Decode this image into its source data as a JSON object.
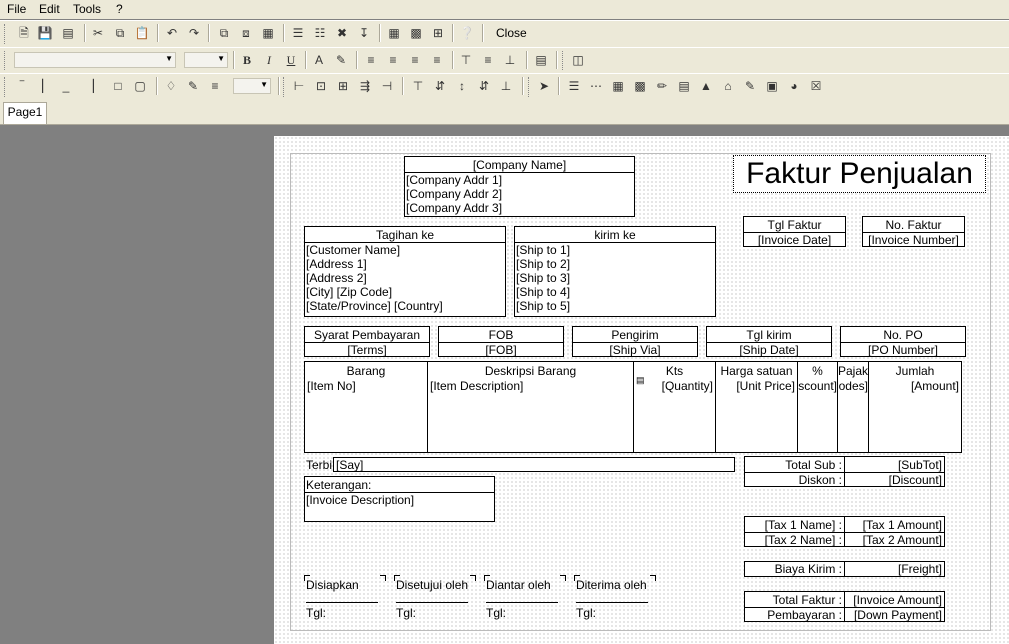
{
  "menu": {
    "file": "File",
    "edit": "Edit",
    "tools": "Tools",
    "help": "?"
  },
  "toolbar": {
    "close_label": "Close"
  },
  "tabs": {
    "page1": "Page1"
  },
  "report": {
    "title": "Faktur Penjualan",
    "company": {
      "name": "[Company Name]",
      "addr1": "[Company Addr 1]",
      "addr2": "[Company Addr 2]",
      "addr3": "[Company Addr 3]"
    },
    "invoice_date_label": "Tgl Faktur",
    "invoice_date": "[Invoice Date]",
    "invoice_no_label": "No. Faktur",
    "invoice_no": "[Invoice Number]",
    "bill_to": {
      "header": "Tagihan ke",
      "lines": [
        "[Customer Name]",
        "[Address 1]",
        "[Address 2]",
        "[City] [Zip Code]",
        "[State/Province] [Country]"
      ]
    },
    "ship_to": {
      "header": "kirim ke",
      "lines": [
        "[Ship to 1]",
        "[Ship to 2]",
        "[Ship to 3]",
        "[Ship to 4]",
        "[Ship to 5]"
      ]
    },
    "info": [
      {
        "label": "Syarat Pembayaran",
        "value": "[Terms]"
      },
      {
        "label": "FOB",
        "value": "[FOB]"
      },
      {
        "label": "Pengirim",
        "value": "[Ship Via]"
      },
      {
        "label": "Tgl kirim",
        "value": "[Ship Date]"
      },
      {
        "label": "No. PO",
        "value": "[PO Number]"
      }
    ],
    "items": {
      "headers": {
        "item": "Barang",
        "desc": "Deskripsi Barang",
        "qty": "Kts",
        "price": "Harga satuan",
        "disc": "%",
        "tax": "Pajak",
        "amount": "Jumlah"
      },
      "fields": {
        "item": "[Item No]",
        "desc": "[Item Description]",
        "qty": "[Quantity]",
        "price": "[Unit Price]",
        "disc": "[Discount]",
        "tax": "[Codes]",
        "amount": "[Amount]"
      }
    },
    "say_label": "Terbilang",
    "say": "[Say]",
    "note_label": "Keterangan:",
    "note": "[Invoice Description]",
    "totals": {
      "subtotal_label": "Total Sub :",
      "subtotal": "[SubTot]",
      "discount_label": "Diskon :",
      "discount": "[Discount]",
      "tax1_label": "[Tax 1 Name] :",
      "tax1": "[Tax 1 Amount]",
      "tax2_label": "[Tax 2 Name] :",
      "tax2": "[Tax 2 Amount]",
      "freight_label": "Biaya Kirim :",
      "freight": "[Freight]",
      "total_label": "Total Faktur :",
      "total": "[Invoice Amount]",
      "payment_label": "Pembayaran :",
      "payment": "[Down Payment]"
    },
    "signatures": [
      {
        "label": "Disiapkan",
        "date": "Tgl:"
      },
      {
        "label": "Disetujui oleh",
        "date": "Tgl:"
      },
      {
        "label": "Diantar oleh",
        "date": "Tgl:"
      },
      {
        "label": "Diterima oleh",
        "date": "Tgl:"
      }
    ]
  }
}
